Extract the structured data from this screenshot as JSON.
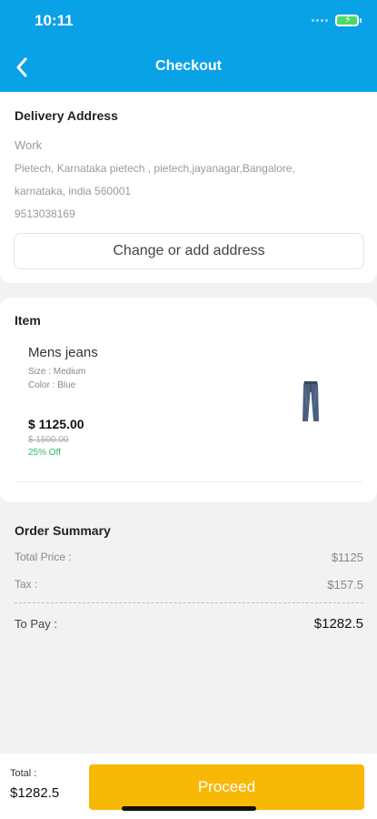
{
  "status_bar": {
    "time": "10:11"
  },
  "header": {
    "title": "Checkout",
    "back_icon": "chevron-left-icon"
  },
  "delivery": {
    "title": "Delivery Address",
    "label": "Work",
    "line1": "Pietech, Karnataka pietech , pietech,jayanagar,Bangalore,",
    "line2": "karnataka, india 560001",
    "phone": "9513038169",
    "change_button": "Change or add address"
  },
  "item": {
    "title": "Item",
    "name": "Mens jeans",
    "size": "Size : Medium",
    "color": "Color : Blue",
    "price": "$ 1125.00",
    "original_price": "$ 1500.00",
    "discount": "25% Off"
  },
  "summary": {
    "title": "Order Summary",
    "total_price_label": "Total Price :",
    "total_price_value": "$1125",
    "tax_label": "Tax :",
    "tax_value": "$157.5",
    "to_pay_label": "To Pay :",
    "to_pay_value": "$1282.5"
  },
  "footer": {
    "total_label": "Total :",
    "total_value": "$1282.5",
    "proceed_button": "Proceed"
  },
  "colors": {
    "primary": "#0aa2e6",
    "accent": "#f8b806",
    "discount": "#2eb872",
    "background": "#f2f2f2"
  }
}
